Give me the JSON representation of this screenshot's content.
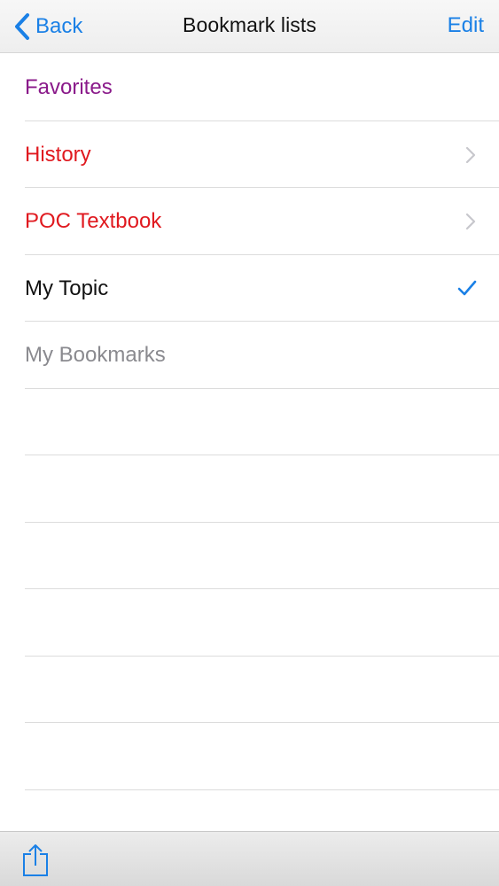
{
  "colors": {
    "accent": "#1a80e6",
    "favorites": "#8a1a8a",
    "history": "#e0191f",
    "textbook": "#e0191f",
    "topic": "#111111",
    "bookmarks": "#8a8a8f",
    "chevron": "#c7c7cc"
  },
  "navbar": {
    "back_label": "Back",
    "title": "Bookmark lists",
    "edit_label": "Edit"
  },
  "list": {
    "items": [
      {
        "label": "Favorites",
        "accessory": "none"
      },
      {
        "label": "History",
        "accessory": "chevron-right-icon"
      },
      {
        "label": "POC Textbook",
        "accessory": "chevron-right-icon"
      },
      {
        "label": "My Topic",
        "accessory": "checkmark-icon"
      },
      {
        "label": "My Bookmarks",
        "accessory": "none"
      }
    ]
  },
  "toolbar": {
    "share_icon": "share-icon"
  }
}
